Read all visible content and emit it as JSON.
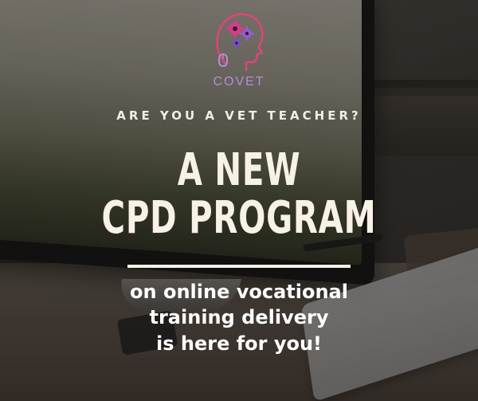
{
  "logo": {
    "text": "COVET",
    "icon": "head-with-gears-icon",
    "colors": {
      "gear_pink": "#d63b8c",
      "gear_purple": "#7b4fc4",
      "outline": "#e0447a"
    }
  },
  "kicker": "ARE YOU A VET TEACHER?",
  "headline": {
    "line1": "A NEW",
    "line2": "CPD PROGRAM"
  },
  "tagline": {
    "line1": "on online vocational",
    "line2": "training delivery",
    "line3": "is here for you!"
  },
  "colors": {
    "text_primary": "#f7f1e6",
    "logo_text": "#b58cd6",
    "divider": "#f5f0e8"
  }
}
